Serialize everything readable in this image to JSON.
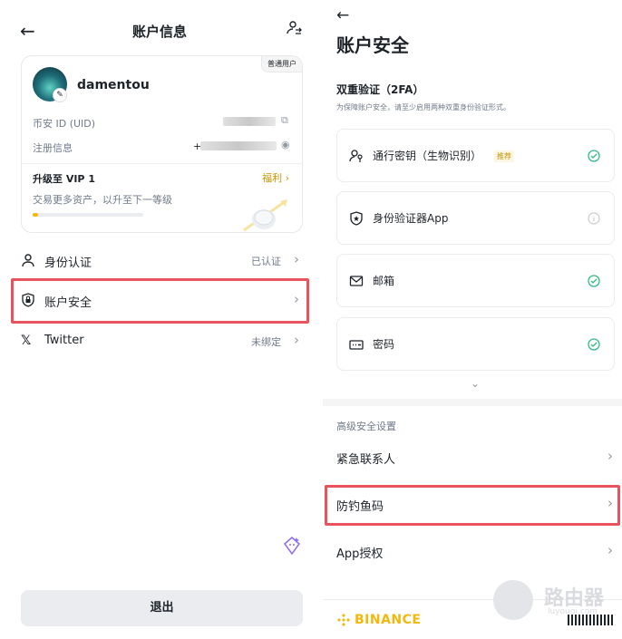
{
  "left": {
    "title": "账户信息",
    "card": {
      "badge": "普通用户",
      "username": "damentou",
      "uid_label": "币安 ID (UID)",
      "reg_label": "注册信息",
      "reg_prefix": "+",
      "vip_title": "升级至 VIP 1",
      "vip_sub": "交易更多资产，以升至下一等级",
      "benefit": "福利",
      "progress": 0.05
    },
    "menu": [
      {
        "label": "身份认证",
        "value": "已认证"
      },
      {
        "label": "账户安全",
        "value": ""
      },
      {
        "label": "Twitter",
        "value": "未绑定"
      }
    ],
    "logout": "退出"
  },
  "right": {
    "title": "账户安全",
    "twofa_title": "双重验证（2FA）",
    "twofa_sub": "为保障账户安全，请至少启用两种双重身份验证形式。",
    "methods": [
      {
        "label": "通行密钥（生物识别）",
        "tag": "推荐",
        "icon": "passkey-icon",
        "status": "enabled"
      },
      {
        "label": "身份验证器App",
        "tag": "",
        "icon": "authenticator-icon",
        "status": "info"
      },
      {
        "label": "邮箱",
        "tag": "",
        "icon": "mail-icon",
        "status": "enabled"
      },
      {
        "label": "密码",
        "tag": "",
        "icon": "password-icon",
        "status": "enabled"
      }
    ],
    "advanced_title": "高级安全设置",
    "settings": [
      {
        "label": "紧急联系人"
      },
      {
        "label": "防钓鱼码"
      },
      {
        "label": "App授权"
      }
    ],
    "brand": "BINANCE",
    "watermark": {
      "text": "路由器",
      "sub": "luyouqi.com"
    }
  },
  "colors": {
    "accent": "#f0b90b",
    "highlight": "#e8535e",
    "success": "#2ebd85"
  }
}
